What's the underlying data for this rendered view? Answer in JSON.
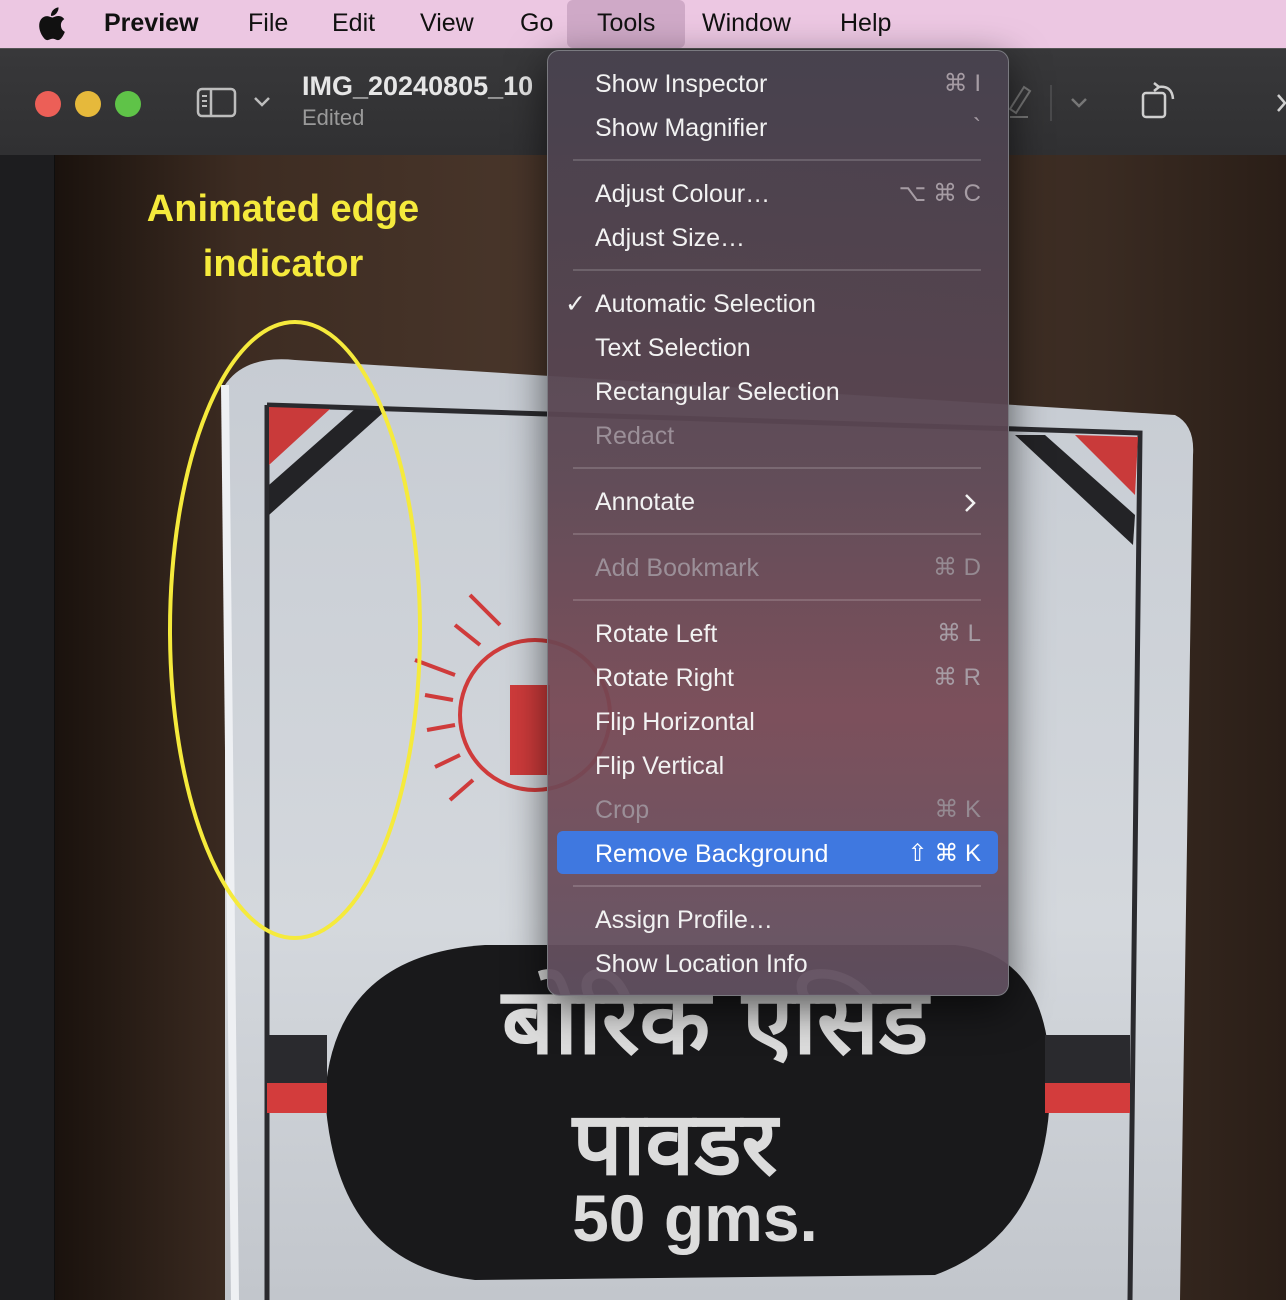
{
  "menubar": {
    "app_name": "Preview",
    "items": [
      "File",
      "Edit",
      "View",
      "Go",
      "Tools",
      "Window",
      "Help"
    ]
  },
  "window": {
    "title": "IMG_20240805_10",
    "subtitle": "Edited"
  },
  "annotation": {
    "line1": "Animated edge",
    "line2": "indicator",
    "color": "#f5ea3c"
  },
  "tools_menu": {
    "items": [
      {
        "label": "Show Inspector",
        "shortcut": "⌘ I"
      },
      {
        "label": "Show Magnifier",
        "shortcut": "`"
      },
      {
        "label": "Adjust Colour…",
        "shortcut": "⌥ ⌘ C"
      },
      {
        "label": "Adjust Size…",
        "shortcut": ""
      },
      {
        "label": "Automatic Selection",
        "shortcut": "",
        "checked": true
      },
      {
        "label": "Text Selection",
        "shortcut": ""
      },
      {
        "label": "Rectangular Selection",
        "shortcut": ""
      },
      {
        "label": "Redact",
        "shortcut": "",
        "disabled": true
      },
      {
        "label": "Annotate",
        "shortcut": "›",
        "submenu": true
      },
      {
        "label": "Add Bookmark",
        "shortcut": "⌘ D",
        "disabled": true
      },
      {
        "label": "Rotate Left",
        "shortcut": "⌘ L"
      },
      {
        "label": "Rotate Right",
        "shortcut": "⌘ R"
      },
      {
        "label": "Flip Horizontal",
        "shortcut": ""
      },
      {
        "label": "Flip Vertical",
        "shortcut": ""
      },
      {
        "label": "Crop",
        "shortcut": "⌘ K",
        "disabled": true
      },
      {
        "label": "Remove Background",
        "shortcut": "⇧ ⌘ K",
        "highlighted": true
      },
      {
        "label": "Assign Profile…",
        "shortcut": ""
      },
      {
        "label": "Show Location Info",
        "shortcut": ""
      }
    ],
    "checkmark": "✓",
    "highlight_color": "#3f78e0"
  },
  "photo": {
    "hindi_line1": "बोरिक एसिड",
    "hindi_line2": "पावडर",
    "weight": "50 gms."
  }
}
